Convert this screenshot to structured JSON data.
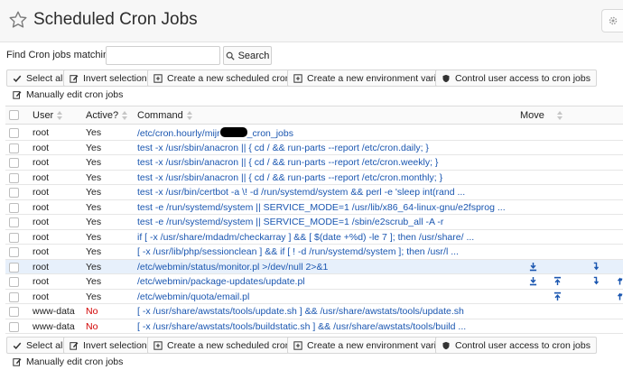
{
  "header": {
    "title": "Scheduled Cron Jobs"
  },
  "search": {
    "label": "Find Cron jobs matching",
    "placeholder": "",
    "value": "",
    "button_label": "Search"
  },
  "toolbar": {
    "select_all": "Select all",
    "invert_selection": "Invert selection",
    "create_job": "Create a new scheduled cron job",
    "create_env": "Create a new environment variable",
    "control_access": "Control user access to cron jobs",
    "manual_edit": "Manually edit cron jobs"
  },
  "table": {
    "headers": {
      "user": "User",
      "active": "Active?",
      "command": "Command",
      "move": "Move"
    },
    "rows": [
      {
        "user": "root",
        "active": "Yes",
        "command_prefix": "/etc/cron.hourly/mijr",
        "command_suffix": "_cron_jobs",
        "redacted": true
      },
      {
        "user": "root",
        "active": "Yes",
        "command": "test -x /usr/sbin/anacron || { cd / && run-parts --report /etc/cron.daily; }"
      },
      {
        "user": "root",
        "active": "Yes",
        "command": "test -x /usr/sbin/anacron || { cd / && run-parts --report /etc/cron.weekly; }"
      },
      {
        "user": "root",
        "active": "Yes",
        "command": "test -x /usr/sbin/anacron || { cd / && run-parts --report /etc/cron.monthly; }"
      },
      {
        "user": "root",
        "active": "Yes",
        "command": "test -x /usr/bin/certbot -a \\! -d /run/systemd/system && perl -e 'sleep int(rand ..."
      },
      {
        "user": "root",
        "active": "Yes",
        "command": "test -e /run/systemd/system || SERVICE_MODE=1 /usr/lib/x86_64-linux-gnu/e2fsprog ..."
      },
      {
        "user": "root",
        "active": "Yes",
        "command": "test -e /run/systemd/system || SERVICE_MODE=1 /sbin/e2scrub_all -A -r"
      },
      {
        "user": "root",
        "active": "Yes",
        "command": "if [ -x /usr/share/mdadm/checkarray ] && [ $(date +%d) -le 7 ]; then /usr/share/ ..."
      },
      {
        "user": "root",
        "active": "Yes",
        "command": "[ -x /usr/lib/php/sessionclean ] && if [ ! -d /run/systemd/system ]; then /usr/l ..."
      },
      {
        "user": "root",
        "active": "Yes",
        "command": "/etc/webmin/status/monitor.pl >/dev/null 2>&1",
        "highlight": true
      },
      {
        "user": "root",
        "active": "Yes",
        "command": "/etc/webmin/package-updates/update.pl"
      },
      {
        "user": "root",
        "active": "Yes",
        "command": "/etc/webmin/quota/email.pl"
      },
      {
        "user": "www-data",
        "active": "No",
        "command": "[ -x /usr/share/awstats/tools/update.sh ] && /usr/share/awstats/tools/update.sh"
      },
      {
        "user": "www-data",
        "active": "No",
        "command": "[ -x /usr/share/awstats/tools/buildstatic.sh ] && /usr/share/awstats/tools/build ..."
      }
    ]
  },
  "icons": {
    "title": "star-icon",
    "settings": "gear-icon",
    "search": "search-icon",
    "select_all": "check-icon",
    "invert": "edit-icon",
    "create": "plus-square-icon",
    "access": "shield-icon",
    "manual": "edit-icon",
    "sort": "sort-icon",
    "move": [
      "move-bottom-icon",
      "move-top-icon",
      "move-down-icon",
      "move-up-icon"
    ]
  },
  "colors": {
    "link": "#1a56b0",
    "inactive": "#d10000",
    "highlight_row": "#e7f0fb",
    "move_arrow": "#1a56b0"
  }
}
